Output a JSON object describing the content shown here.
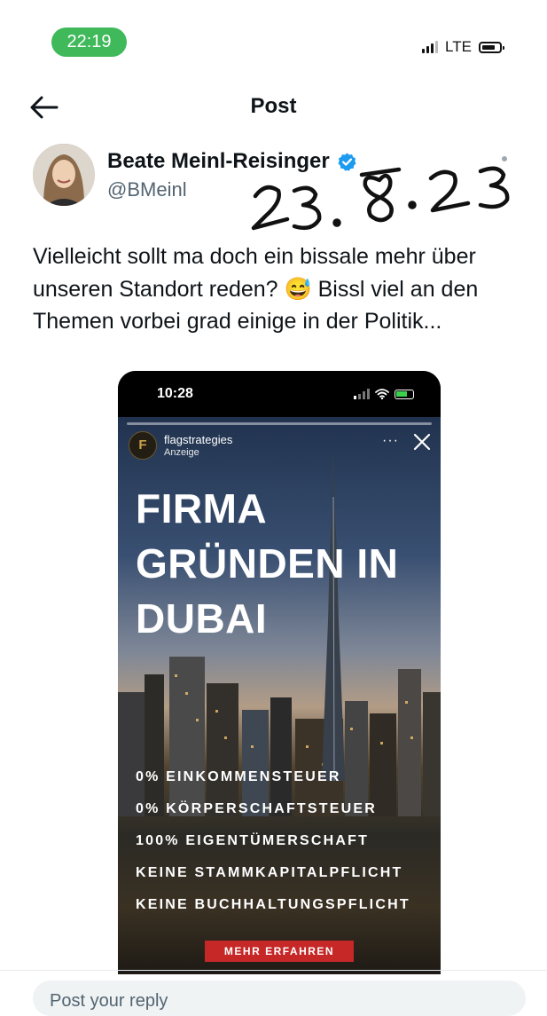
{
  "status_bar": {
    "time": "22:19",
    "network": "LTE"
  },
  "header": {
    "title": "Post"
  },
  "author": {
    "name": "Beate Meinl-Reisinger",
    "handle": "@BMeinl"
  },
  "annotation": {
    "handwritten_date": "23.8.23"
  },
  "tweet": {
    "text": "Vielleicht sollt ma doch ein bissale mehr über unseren Standort reden? 😅 Bissl viel an den Themen vorbei grad einige in der Politik..."
  },
  "media": {
    "phone_time": "10:28",
    "account": "flagstrategies",
    "account_label": "Anzeige",
    "menu": "···",
    "headline": [
      "FIRMA",
      "GRÜNDEN IN",
      "DUBAI"
    ],
    "features": [
      "0% EINKOMMENSTEUER",
      "0% KÖRPERSCHAFTSTEUER",
      "100% EIGENTÜMERSCHAFT",
      "KEINE STAMMKAPITALPFLICHT",
      "KEINE BUCHHALTUNGSPFLICHT"
    ],
    "cta": "MEHR ERFAHREN"
  },
  "reply": {
    "placeholder": "Post your reply"
  },
  "colors": {
    "status_pill": "#3fb95a",
    "verified": "#1d9bf0",
    "cta": "#c62828"
  },
  "icons": [
    "back-arrow-icon",
    "verified-badge-icon",
    "signal-icon",
    "battery-icon",
    "wifi-icon",
    "close-icon"
  ]
}
